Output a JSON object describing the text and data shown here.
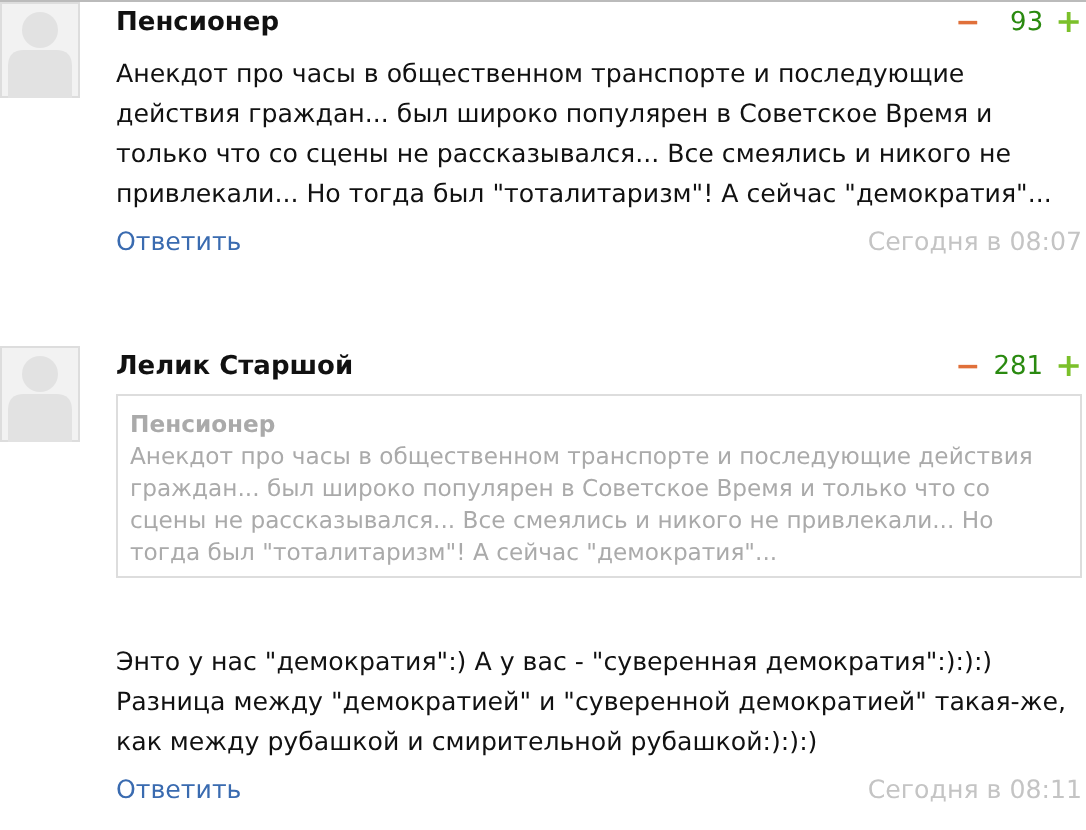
{
  "comments": [
    {
      "author": "Пенсионер",
      "minus": "−",
      "rating": "93",
      "plus": "+",
      "text": "Анекдот про часы в общественном транспорте и последующие действия граждан... был широко популярен в Советское Время и только что со сцены не рассказывался... Все смеялись и никого не привлекали... Но тогда был \"тоталитаризм\"! А сейчас \"демократия\"...",
      "reply": "Ответить",
      "time": "Сегодня в 08:07"
    },
    {
      "author": "Лелик Старшой",
      "minus": "−",
      "rating": "281",
      "plus": "+",
      "quote": {
        "author": "Пенсионер",
        "text": "Анекдот про часы в общественном транспорте и последующие действия граждан... был широко популярен в Советское Время и только что со сцены не рассказывался... Все смеялись и никого не привлекали... Но тогда был \"тоталитаризм\"! А сейчас \"демократия\"..."
      },
      "text": "Энто у нас \"демократия\":) А у вас - \"суверенная демократия\":):):) Разница между \"демократией\" и \"суверенной демократией\" такая-же, как между рубашкой и смирительной рубашкой:):):)",
      "reply": "Ответить",
      "time": "Сегодня в 08:11"
    }
  ]
}
